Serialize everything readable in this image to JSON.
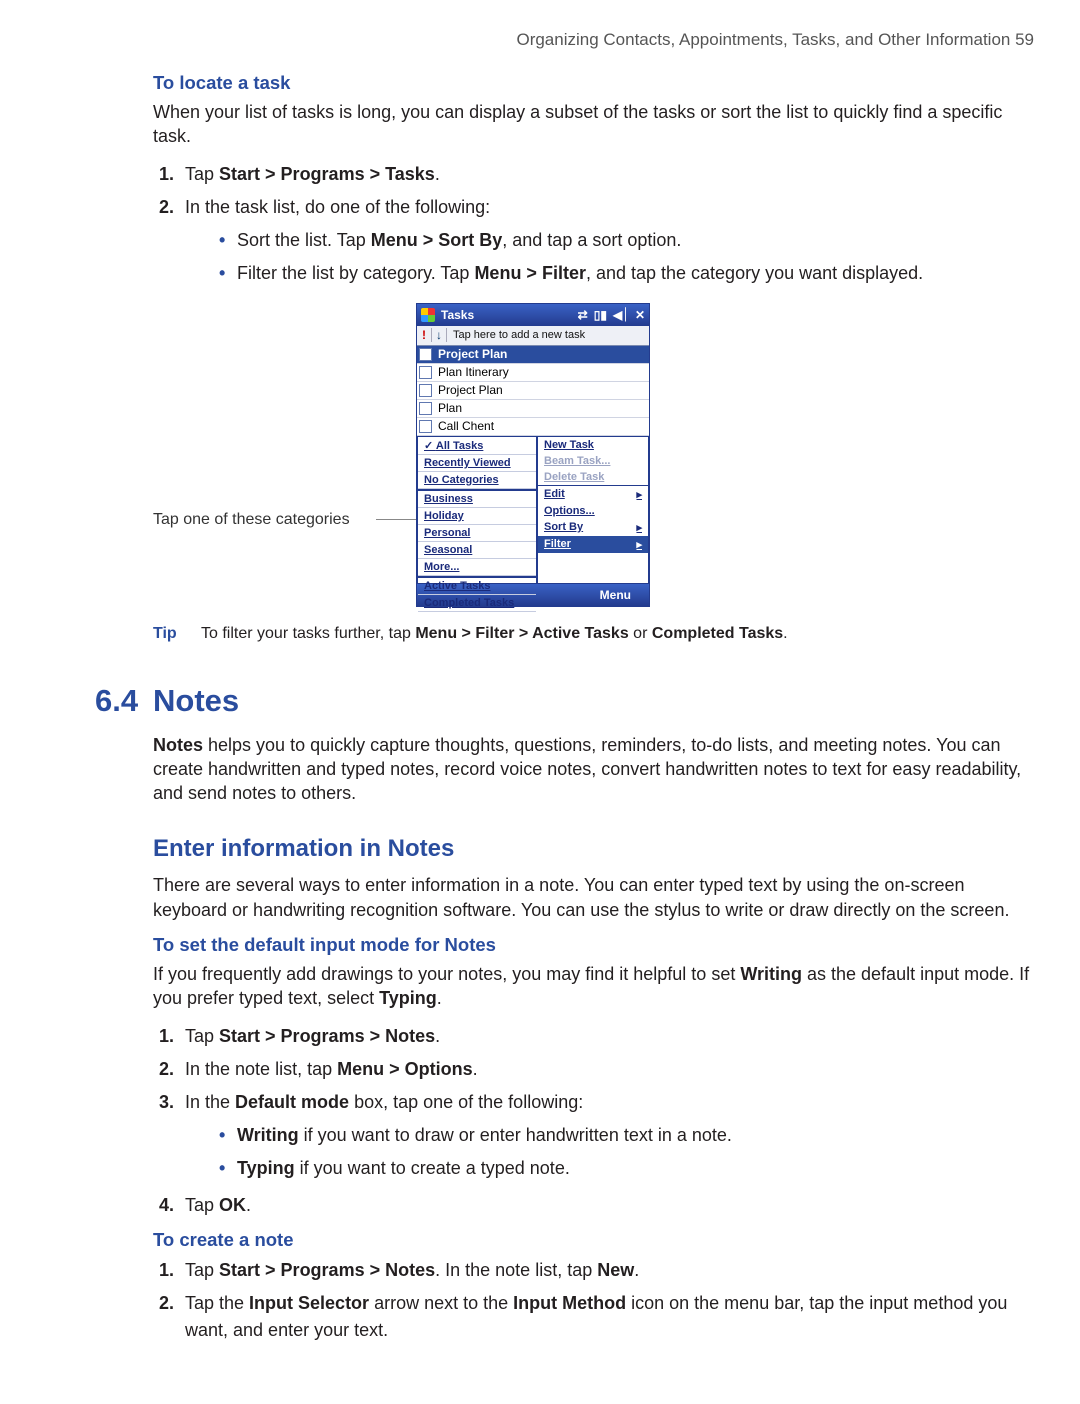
{
  "running_head": "Organizing Contacts, Appointments, Tasks, and Other Information  59",
  "locate": {
    "heading": "To locate a task",
    "intro": "When your list of tasks is long, you can display a subset of the tasks or sort the list to quickly find a specific task.",
    "step1_pre": "Tap ",
    "step1_bold": "Start > Programs > Tasks",
    "step1_post": ".",
    "step2": "In the task list, do one of the following:",
    "bul1_pre": "Sort the list. Tap ",
    "bul1_bold": "Menu > Sort By",
    "bul1_post": ", and tap a sort option.",
    "bul2_pre": "Filter the list by category. Tap ",
    "bul2_bold": "Menu > Filter",
    "bul2_post": ", and tap the category you want displayed."
  },
  "callout": "Tap one of these categories",
  "device": {
    "title": "Tasks",
    "placeholder": "Tap here to add a new task",
    "rows": [
      "Project Plan",
      "Plan Itinerary",
      "Project Plan",
      "Plan",
      "Call Chent"
    ],
    "filter_menu": [
      "All Tasks",
      "Recently Viewed",
      "No Categories",
      "Business",
      "Holiday",
      "Personal",
      "Seasonal",
      "More...",
      "Active Tasks",
      "Completed Tasks"
    ],
    "right_menu": [
      {
        "t": "New Task",
        "dis": false
      },
      {
        "t": "Beam Task...",
        "dis": true
      },
      {
        "t": "Delete Task",
        "dis": true
      },
      {
        "t": "Edit",
        "dis": false,
        "arrow": true,
        "sep": true
      },
      {
        "t": "Options...",
        "dis": false
      },
      {
        "t": "Sort By",
        "dis": false,
        "arrow": true
      },
      {
        "t": "Filter",
        "dis": false,
        "arrow": true,
        "sel": true
      }
    ],
    "menu_label": "Menu"
  },
  "tip": {
    "label": "Tip",
    "pre": "To filter your tasks further, tap ",
    "b1": "Menu > Filter > Active Tasks",
    "mid": " or ",
    "b2": "Completed Tasks",
    "post": "."
  },
  "section": {
    "num": "6.4",
    "title": "Notes"
  },
  "notes_intro_b": "Notes",
  "notes_intro": " helps you to quickly capture thoughts, questions, reminders, to-do lists, and meeting notes. You can create handwritten and typed notes, record voice notes, convert handwritten notes to text for easy readability, and send notes to others.",
  "enter_head": "Enter information in Notes",
  "enter_body": "There are several ways to enter information in a note. You can enter typed text by using the on-screen keyboard or handwriting recognition software. You can use the stylus to write or draw directly on the screen.",
  "setmode": {
    "heading": "To set the default input mode for Notes",
    "intro_pre": "If you frequently add drawings to your notes, you may find it helpful to set ",
    "intro_b1": "Writing",
    "intro_mid": " as the default input mode. If you prefer typed text, select ",
    "intro_b2": "Typing",
    "intro_post": ".",
    "s1_pre": "Tap ",
    "s1_b": "Start > Programs > Notes",
    "s1_post": ".",
    "s2_pre": "In the note list, tap ",
    "s2_b": "Menu > Options",
    "s2_post": ".",
    "s3_pre": "In the ",
    "s3_b": "Default mode",
    "s3_post": " box, tap one of the following:",
    "s3b1_b": "Writing",
    "s3b1_post": " if you want to draw or enter handwritten text in a note.",
    "s3b2_b": "Typing",
    "s3b2_post": " if you want to create a typed note.",
    "s4_pre": "Tap ",
    "s4_b": "OK",
    "s4_post": "."
  },
  "create": {
    "heading": "To create a note",
    "s1_pre": "Tap ",
    "s1_b1": "Start > Programs > Notes",
    "s1_mid": ". In the note list, tap ",
    "s1_b2": "New",
    "s1_post": ".",
    "s2_pre": "Tap the ",
    "s2_b1": "Input Selector",
    "s2_mid1": " arrow next to the ",
    "s2_b2": "Input Method",
    "s2_mid2": " icon on the menu bar, tap the input method you want, and enter your text."
  }
}
